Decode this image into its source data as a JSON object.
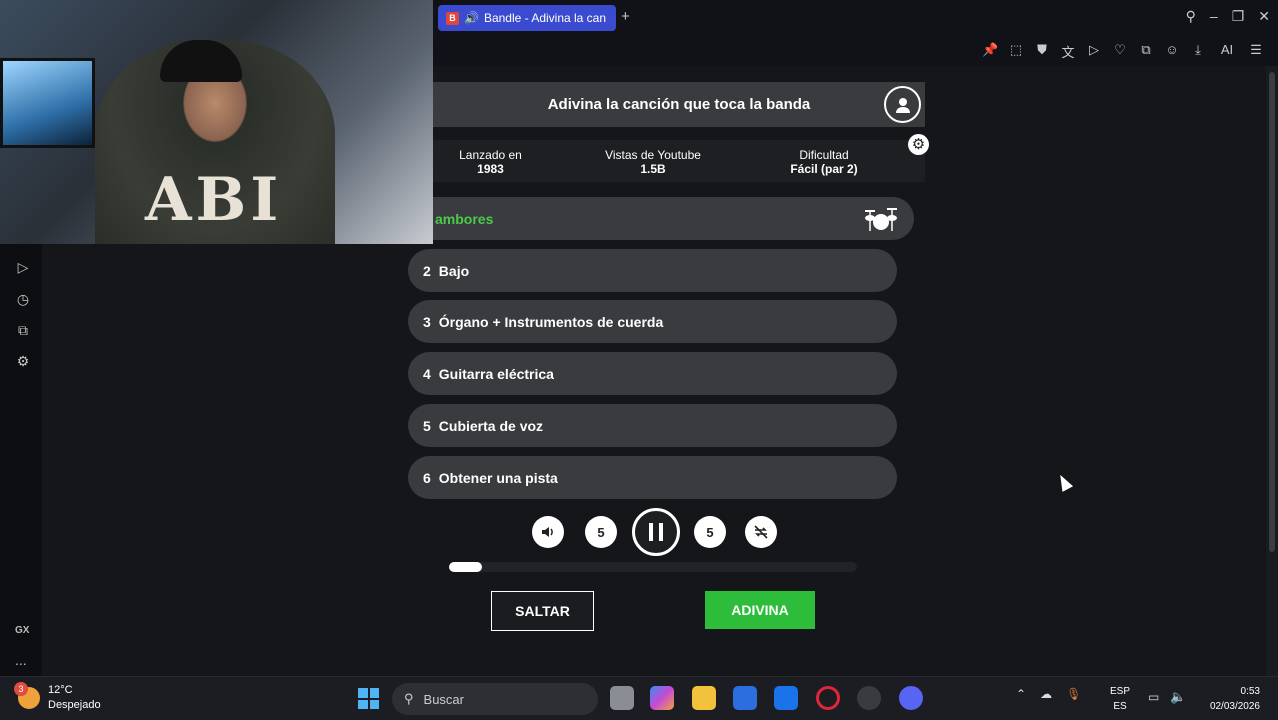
{
  "browser": {
    "tab_title": "Bandle - Adivina la can",
    "new_tab": "+",
    "toolbar_ai": "AI"
  },
  "sidebar": {
    "gx_label": "GX",
    "more": "..."
  },
  "game": {
    "title": "Adivina la canción que toca la banda",
    "info": [
      {
        "label": "Lanzado en",
        "value": "1983"
      },
      {
        "label": "Vistas de Youtube",
        "value": "1.5B"
      },
      {
        "label": "Dificultad",
        "value": "Fácil (par 2)"
      }
    ],
    "active_track": "ambores",
    "tracks": [
      {
        "num": "2",
        "label": "Bajo"
      },
      {
        "num": "3",
        "label": "Órgano + Instrumentos de cuerda"
      },
      {
        "num": "4",
        "label": "Guitarra eléctrica"
      },
      {
        "num": "5",
        "label": "Cubierta de voz"
      },
      {
        "num": "6",
        "label": "Obtener una pista"
      }
    ],
    "rewind_label": "5",
    "forward_label": "5",
    "progress_fraction": 0.08,
    "skip_label": "SALTAR",
    "guess_label": "ADIVINA",
    "accent_color": "#2ebd3a"
  },
  "taskbar": {
    "weather_badge": "3",
    "temperature": "12°C",
    "weather_text": "Despejado",
    "search_placeholder": "Buscar",
    "lang_top": "ESP",
    "lang_bottom": "ES",
    "time": "0:53",
    "date": "02/03/2026"
  }
}
